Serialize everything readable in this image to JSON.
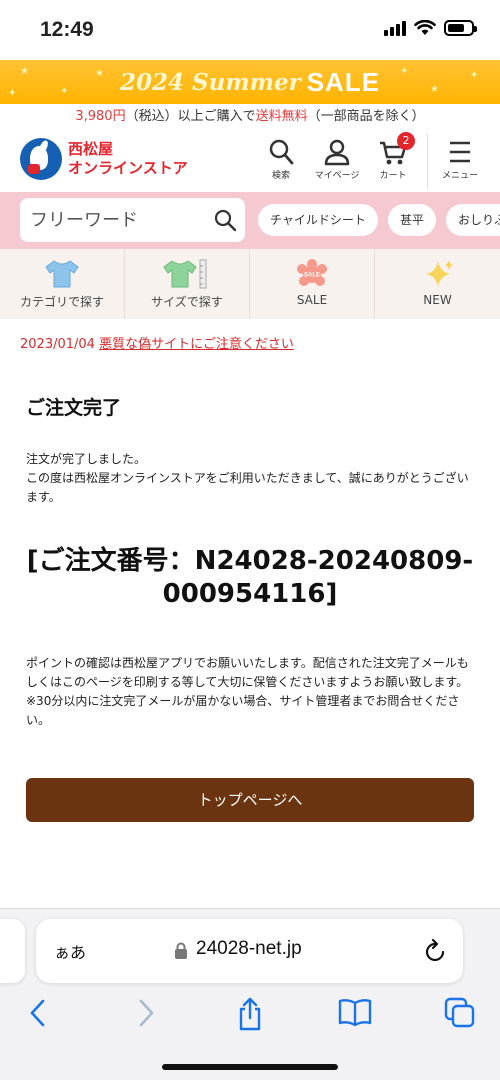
{
  "status": {
    "time": "12:49"
  },
  "banner": {
    "year": "2024 Summer",
    "sale": "SALE"
  },
  "shipping": {
    "price": "3,980円",
    "mid": "（税込）以上ご購入で",
    "free": "送料無料",
    "tail": "（一部商品を除く）"
  },
  "logo": {
    "line1": "西松屋",
    "line2": "オンラインストア"
  },
  "header": {
    "search_label": "検索",
    "mypage_label": "マイページ",
    "cart_label": "カート",
    "cart_count": "2",
    "menu_label": "メニュー"
  },
  "search": {
    "placeholder": "フリーワード",
    "chips": [
      "チャイルドシート",
      "甚平",
      "おしりふき"
    ]
  },
  "categories": [
    {
      "label": "カテゴリで探す",
      "icon": "blue-tshirt-icon"
    },
    {
      "label": "サイズで探す",
      "icon": "green-tshirt-ruler-icon"
    },
    {
      "label": "SALE",
      "icon": "sale-flower-icon"
    },
    {
      "label": "NEW",
      "icon": "sparkle-icon"
    }
  ],
  "notice": {
    "date": "2023/01/04",
    "link": "悪質な偽サイトにご注意ください"
  },
  "order": {
    "title": "ご注文完了",
    "message_1": "注文が完了しました。",
    "message_2": "この度は西松屋オンラインストアをご利用いただきまして、誠にありがとうございます。",
    "number_line1": "[ご注文番号：N24028-20240809-",
    "number_line2": "000954116]",
    "note_1": "ポイントの確認は西松屋アプリでお願いいたします。配信された注文完了メールもしくはこのページを印刷する等して大切に保管くださいますようお願い致します。",
    "note_2": "※30分以内に注文完了メールが届かない場合、サイト管理者までお問合せください。",
    "top_button": "トップページへ"
  },
  "safari": {
    "aa": "ぁあ",
    "url": "24028-net.jp"
  },
  "colors": {
    "brand_red": "#e3262e",
    "banner_yellow": "#ffb400",
    "search_pink": "#f6c8cf",
    "button_brown": "#6b3410",
    "safari_blue": "#1a73e8"
  }
}
